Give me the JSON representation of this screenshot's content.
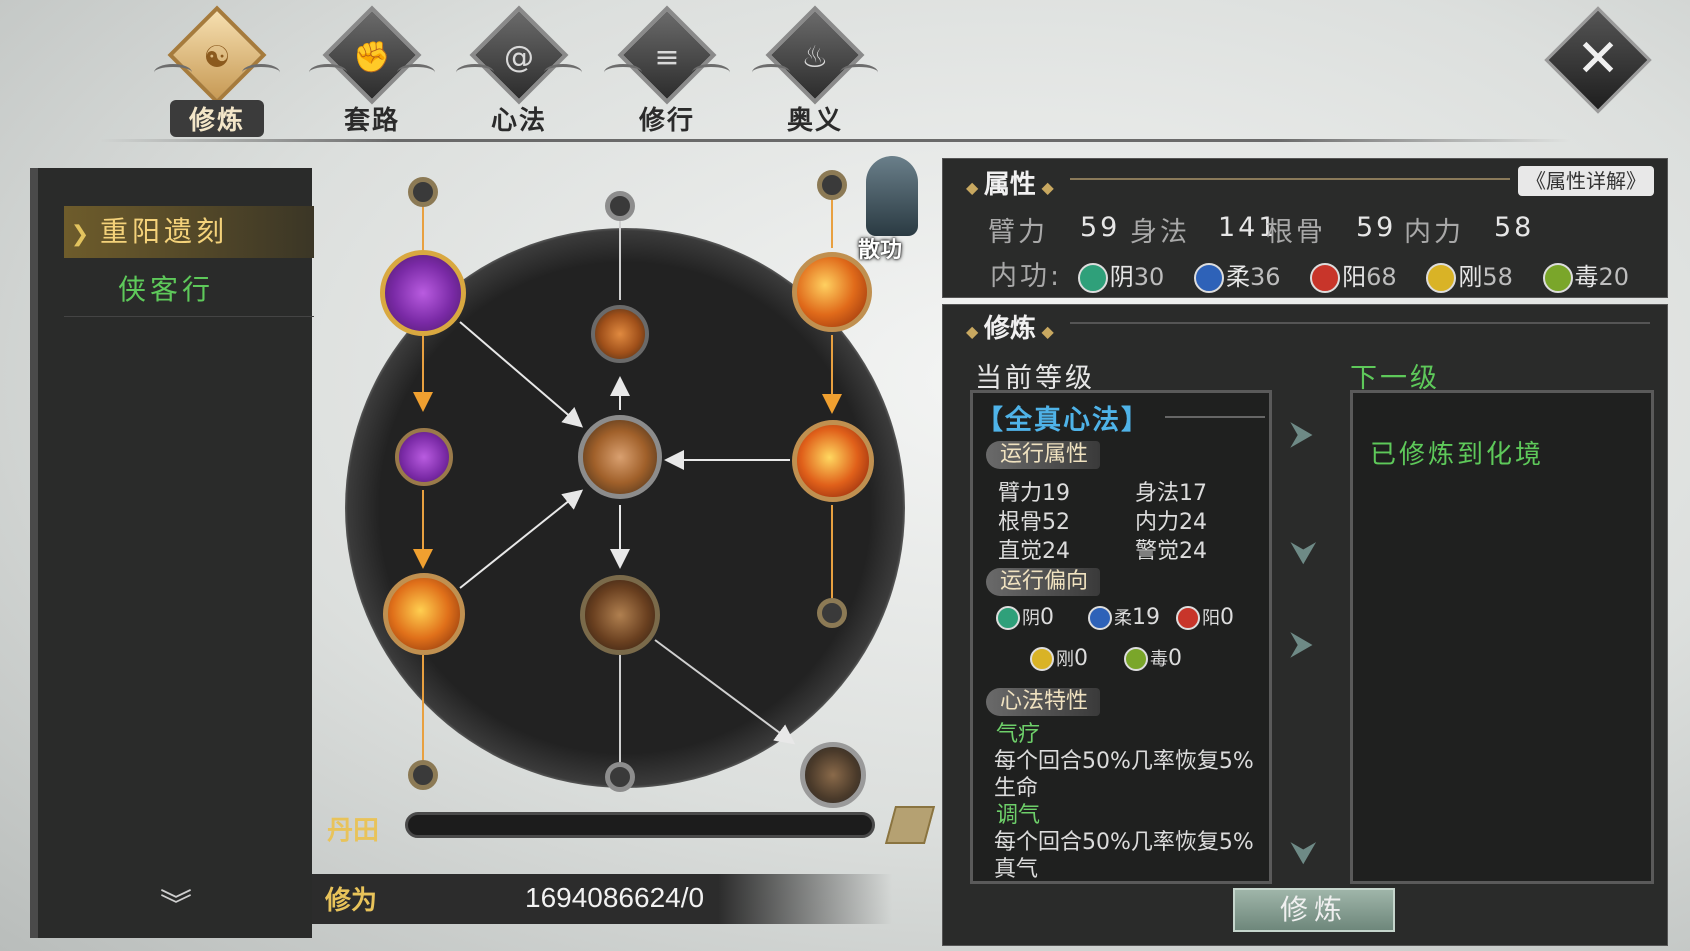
{
  "tabs": [
    {
      "label": "修炼",
      "icon": "yin-yang-icon",
      "active": true
    },
    {
      "label": "套路",
      "icon": "fist-icon",
      "active": false
    },
    {
      "label": "心法",
      "icon": "swirl-icon",
      "active": false
    },
    {
      "label": "修行",
      "icon": "scroll-icon",
      "active": false
    },
    {
      "label": "奥义",
      "icon": "flame-icon",
      "active": false
    }
  ],
  "close_glyph": "✕",
  "left_list": {
    "items": [
      {
        "label": "重阳遗刻",
        "selected": true
      },
      {
        "label": "侠客行",
        "selected": false
      }
    ],
    "selected_marker": "❯",
    "scroll_down_glyph": "︾"
  },
  "tree": {
    "sangong_label": "散功",
    "dantian_label": "丹田",
    "xiuwei_label": "修为",
    "xiuwei_value": "1694086624/0"
  },
  "attributes": {
    "title": "属性",
    "detail_button": "《属性详解》",
    "stats": [
      {
        "label": "臂力",
        "value": "59"
      },
      {
        "label": "身法",
        "value": "141"
      },
      {
        "label": "根骨",
        "value": "59"
      },
      {
        "label": "内力",
        "value": "58"
      }
    ],
    "neigong_label": "内功:",
    "neigong": [
      {
        "name": "阴",
        "value": "30",
        "color": "#2fa07a"
      },
      {
        "name": "柔",
        "value": "36",
        "color": "#2e62b8"
      },
      {
        "name": "阳",
        "value": "68",
        "color": "#c8352a"
      },
      {
        "name": "刚",
        "value": "58",
        "color": "#d9b326"
      },
      {
        "name": "毒",
        "value": "20",
        "color": "#7aa62a"
      }
    ]
  },
  "cultivation": {
    "title": "修炼",
    "current_level_label": "当前等级",
    "next_level_label": "下一级",
    "skill_name": "【全真心法】",
    "run_attr_tag": "运行属性",
    "run_attrs": [
      {
        "label": "臂力",
        "value": "19"
      },
      {
        "label": "身法",
        "value": "17"
      },
      {
        "label": "根骨",
        "value": "52"
      },
      {
        "label": "内力",
        "value": "24"
      },
      {
        "label": "直觉",
        "value": "24"
      },
      {
        "label": "警觉",
        "value": "24"
      }
    ],
    "bias_tag": "运行偏向",
    "bias": [
      {
        "name": "阴",
        "value": "0",
        "color": "#2fa07a"
      },
      {
        "name": "柔",
        "value": "19",
        "color": "#2e62b8"
      },
      {
        "name": "阳",
        "value": "0",
        "color": "#c8352a"
      },
      {
        "name": "刚",
        "value": "0",
        "color": "#d9b326"
      },
      {
        "name": "毒",
        "value": "0",
        "color": "#7aa62a"
      }
    ],
    "trait_tag": "心法特性",
    "traits": [
      {
        "name": "气疗",
        "desc1": "每个回合50%几率恢复5%",
        "desc2": "生命"
      },
      {
        "name": "调气",
        "desc1": "每个回合50%几率恢复5%",
        "desc2": "真气"
      }
    ],
    "next_level_text": "已修炼到化境",
    "train_button": "修炼"
  },
  "colors": {
    "accent_gold": "#e8c35a",
    "green_text": "#5ec95a",
    "skill_name_blue": "#4fb3e8"
  }
}
